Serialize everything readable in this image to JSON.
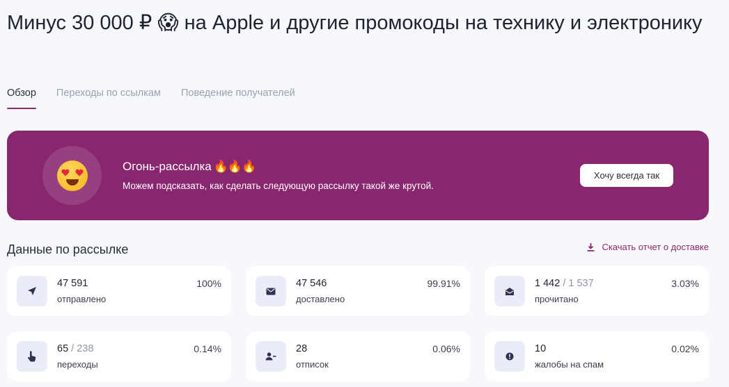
{
  "page": {
    "title": "Минус 30 000 ₽ 😱 на Apple и другие промокоды на технику и электронику"
  },
  "tabs": [
    {
      "label": "Обзор",
      "active": true
    },
    {
      "label": "Переходы по ссылкам",
      "active": false
    },
    {
      "label": "Поведение получателей",
      "active": false
    }
  ],
  "banner": {
    "icon": "heart-eyes-emoji",
    "title": "Огонь-рассылка",
    "fires": "🔥🔥🔥",
    "subtitle": "Можем подсказать, как сделать следующую рассылку такой же крутой.",
    "button_label": "Хочу всегда так",
    "background": "#892670"
  },
  "stats_section": {
    "title": "Данные по рассылке",
    "download_label": "Скачать отчет о доставке",
    "download_icon": "download-icon"
  },
  "stats": [
    {
      "icon": "send-icon",
      "value": "47 591",
      "total": "",
      "label": "отправлено",
      "percent": "100%"
    },
    {
      "icon": "envelope-icon",
      "value": "47 546",
      "total": "",
      "label": "доставлено",
      "percent": "99.91%"
    },
    {
      "icon": "open-envelope-icon",
      "value": "1 442",
      "total": " / 1 537",
      "label": "прочитано",
      "percent": "3.03%"
    },
    {
      "icon": "pointer-hand-icon",
      "value": "65",
      "total": " / 238",
      "label": "переходы",
      "percent": "0.14%"
    },
    {
      "icon": "user-minus-icon",
      "value": "28",
      "total": "",
      "label": "отписок",
      "percent": "0.06%"
    },
    {
      "icon": "alert-circle-icon",
      "value": "10",
      "total": "",
      "label": "жалобы на спам",
      "percent": "0.02%"
    }
  ],
  "colors": {
    "accent": "#8a2a6e",
    "icon_tile": "#eaedf8",
    "icon_fill": "#2d3350"
  }
}
